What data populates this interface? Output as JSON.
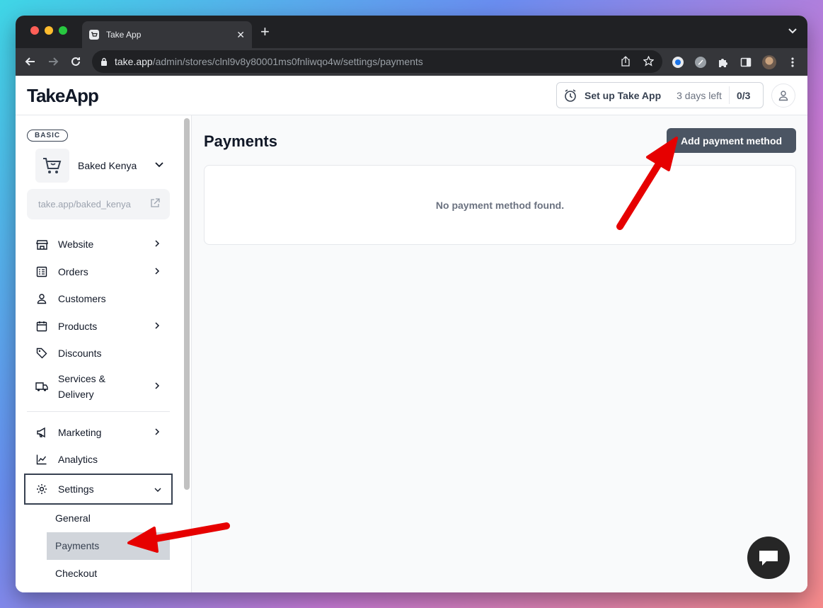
{
  "browser": {
    "tab_title": "Take App",
    "url_host": "take.app",
    "url_path": "/admin/stores/clnl9v8y80001ms0fnliwqo4w/settings/payments",
    "traffic_colors": [
      "#ff5f57",
      "#febc2e",
      "#28c840"
    ]
  },
  "header": {
    "logo": "TakeApp",
    "setup_label": "Set up Take App",
    "days_left": "3 days left",
    "progress": "0/3"
  },
  "sidebar": {
    "plan_badge": "BASIC",
    "store_name": "Baked Kenya",
    "store_link": "take.app/baked_kenya",
    "items": [
      {
        "label": "Website",
        "icon": "store-icon",
        "has_chevron": true
      },
      {
        "label": "Orders",
        "icon": "orders-list-icon",
        "has_chevron": true
      },
      {
        "label": "Customers",
        "icon": "user-icon",
        "has_chevron": false
      },
      {
        "label": "Products",
        "icon": "products-box-icon",
        "has_chevron": true
      },
      {
        "label": "Discounts",
        "icon": "tag-icon",
        "has_chevron": false
      },
      {
        "label": "Services &",
        "label2": "Delivery",
        "icon": "truck-icon",
        "has_chevron": true
      }
    ],
    "items2": [
      {
        "label": "Marketing",
        "icon": "megaphone-icon",
        "has_chevron": true
      },
      {
        "label": "Analytics",
        "icon": "chart-line-icon",
        "has_chevron": false
      }
    ],
    "settings": {
      "label": "Settings",
      "sub": [
        "General",
        "Payments",
        "Checkout"
      ]
    }
  },
  "main": {
    "title": "Payments",
    "add_button": "Add payment method",
    "empty_message": "No payment method found."
  }
}
